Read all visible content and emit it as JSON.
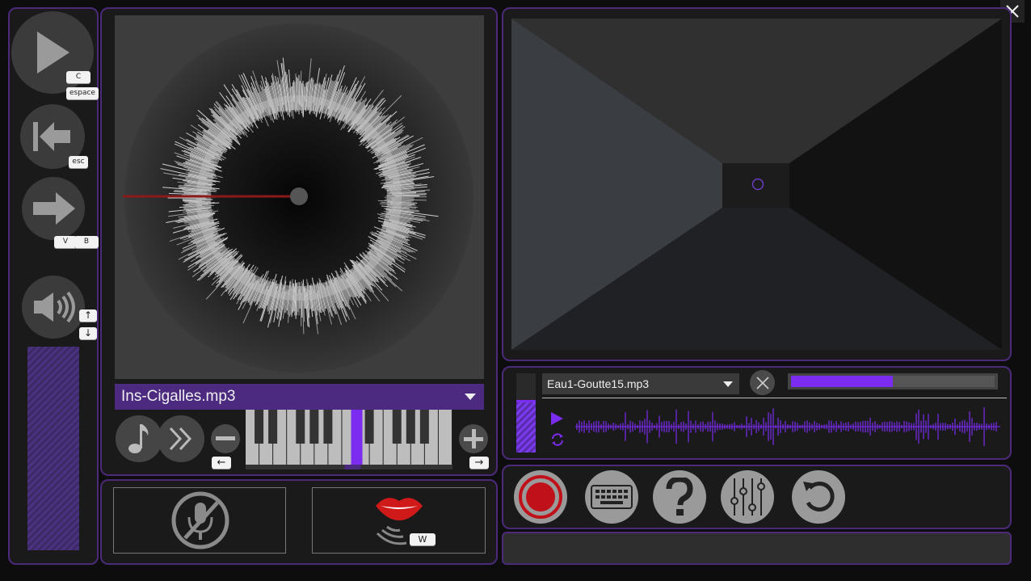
{
  "window": {
    "close_icon": "close-icon"
  },
  "transport": {
    "play_keys": [
      "C",
      "espace"
    ],
    "rewind_key": "esc",
    "next_keys": [
      "V",
      "B"
    ],
    "volume_keys": [
      "↑",
      "↓"
    ],
    "volume_level": 1.0
  },
  "disc": {
    "file_name": "Ins-Cigalles.mp3",
    "playhead_color": "#8a1a1a"
  },
  "keyboard_bar": {
    "minus_key": "←",
    "plus_key": "→",
    "highlight_key_index": 8
  },
  "mic_panel": {
    "mic_icon": "mic-muted-icon",
    "voice_key": "W"
  },
  "sample_player": {
    "file_name": "Eau1-Goutte15.mp3",
    "progress": 0.5,
    "level": 0.65
  },
  "accent_color": "#7b2cf0"
}
